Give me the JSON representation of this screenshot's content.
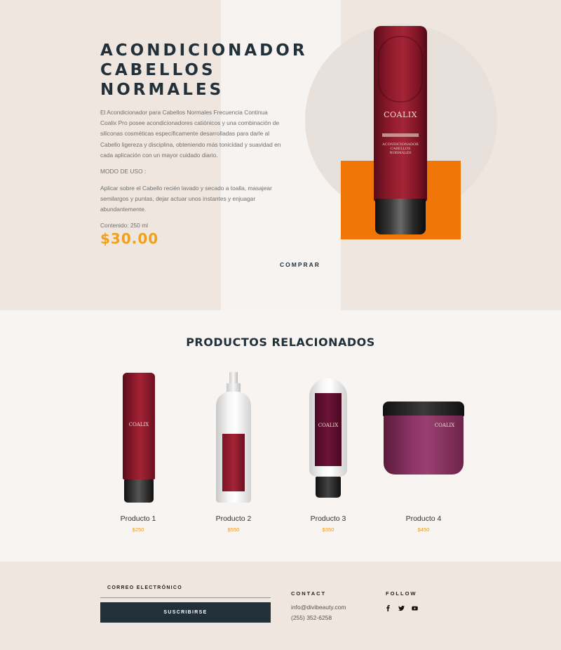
{
  "hero": {
    "title": "ACONDICIONADOR CABELLOS NORMALES",
    "description": "El Acondicionador para Cabellos Normales Frecuencia Continua Coalix Pro posee acondicionadores catiónicos y una combinación de siliconas cosméticas específicamente desarrolladas para darle al Cabello ligereza y disciplina, obteniendo más tonicidad y suavidad en cada aplicación con un mayor cuidado diario.",
    "mode_label": "MODO DE USO :",
    "mode_text": "Aplicar sobre el Cabello recién lavado y secado a toalla, masajear semilargos y puntas, dejar actuar unos instantes y enjuagar abundantemente.",
    "content": "Contenido: 250 ml",
    "price": "$30.00",
    "buy_label": "COMPRAR",
    "product_brand": "COALIX",
    "product_sub": "ACONDICIONADOR CABELLOS NORMALES"
  },
  "related": {
    "title": "PRODUCTOS RELACIONADOS",
    "products": [
      {
        "name": "Producto 1",
        "price": "$250"
      },
      {
        "name": "Producto 2",
        "price": "$550"
      },
      {
        "name": "Producto 3",
        "price": "$350"
      },
      {
        "name": "Producto 4",
        "price": "$450"
      }
    ]
  },
  "footer": {
    "email_label": "CORREO ELECTRÓNICO",
    "subscribe_label": "SUSCRIBIRSE",
    "contact_heading": "CONTACT",
    "contact_email": "info@divibeauty.com",
    "contact_phone": "(255) 352-6258",
    "follow_heading": "FOLLOW",
    "social_icons": [
      "facebook-icon",
      "twitter-icon",
      "youtube-icon"
    ]
  },
  "colors": {
    "accent_orange": "#ef7607",
    "price_color": "#f0a11a",
    "dark_navy": "#22303a",
    "hero_bg": "#efe6df"
  }
}
